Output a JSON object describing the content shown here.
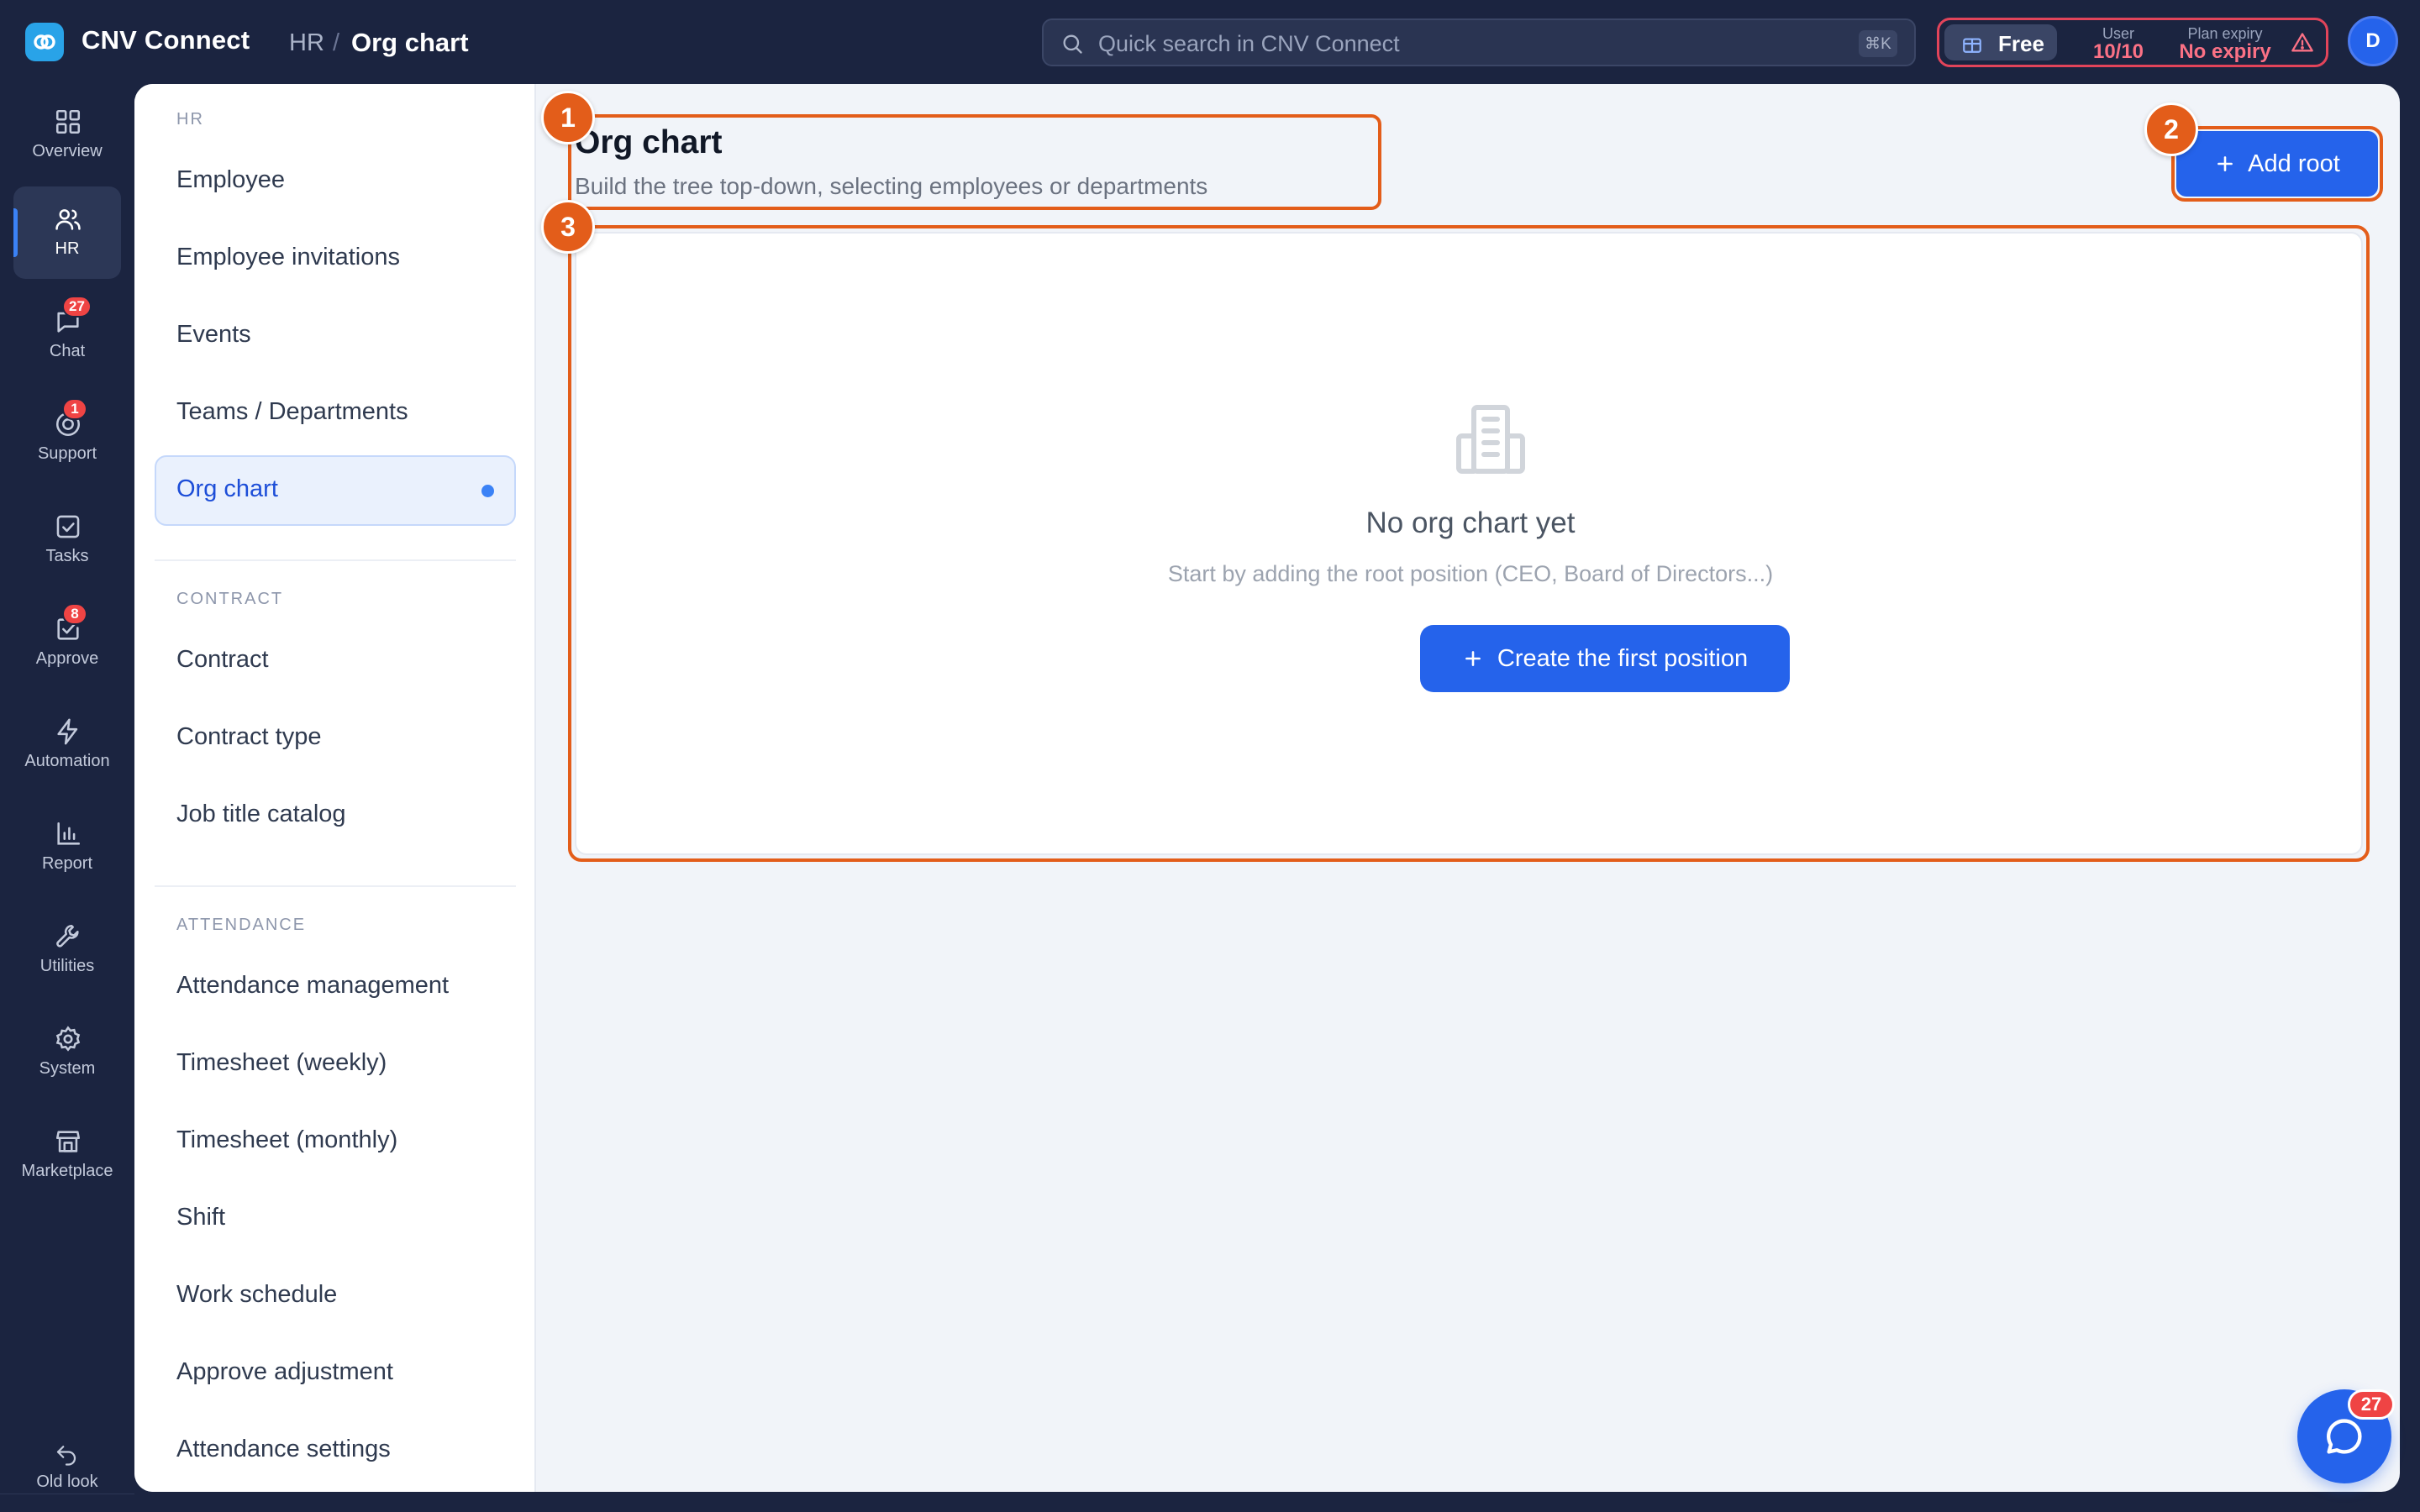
{
  "topbar": {
    "app_name": "CNV Connect",
    "breadcrumb": {
      "root": "HR",
      "separator": "/",
      "current": "Org chart"
    },
    "search": {
      "placeholder": "Quick search in CNV Connect",
      "shortcut": "⌘K"
    },
    "plan": {
      "name": "Free",
      "user_caption": "User",
      "user_value": "10/10",
      "expiry_caption": "Plan expiry",
      "expiry_value": "No expiry"
    },
    "avatar_initial": "D"
  },
  "rail": {
    "items": [
      {
        "label": "Overview",
        "icon": "grid-icon"
      },
      {
        "label": "HR",
        "icon": "users-icon",
        "active": true
      },
      {
        "label": "Chat",
        "icon": "chat-icon",
        "badge": "27"
      },
      {
        "label": "Support",
        "icon": "support-icon",
        "badge": "1"
      },
      {
        "label": "Tasks",
        "icon": "task-check-icon"
      },
      {
        "label": "Approve",
        "icon": "approve-icon",
        "badge": "8"
      },
      {
        "label": "Automation",
        "icon": "lightning-icon"
      },
      {
        "label": "Report",
        "icon": "bar-chart-icon"
      },
      {
        "label": "Utilities",
        "icon": "wrench-icon"
      },
      {
        "label": "System",
        "icon": "gear-icon"
      },
      {
        "label": "Marketplace",
        "icon": "store-icon"
      }
    ],
    "old_look": "Old look"
  },
  "subnav": {
    "sections": [
      {
        "title": "HR",
        "items": [
          "Employee",
          "Employee invitations",
          "Events",
          "Teams / Departments",
          "Org chart"
        ]
      },
      {
        "title": "CONTRACT",
        "items": [
          "Contract",
          "Contract type",
          "Job title catalog"
        ]
      },
      {
        "title": "ATTENDANCE",
        "items": [
          "Attendance management",
          "Timesheet (weekly)",
          "Timesheet (monthly)",
          "Shift",
          "Work schedule",
          "Approve adjustment",
          "Attendance settings"
        ]
      }
    ],
    "active_item": "Org chart"
  },
  "main": {
    "title": "Org chart",
    "subtitle": "Build the tree top-down, selecting employees or departments",
    "add_root_label": "Add root",
    "empty": {
      "title": "No org chart yet",
      "subtitle": "Start by adding the root position (CEO, Board of Directors...)",
      "button": "Create the first position"
    },
    "callouts": [
      "1",
      "2",
      "3"
    ]
  },
  "chat_fab": {
    "badge": "27"
  },
  "colors": {
    "shell": "#1b2440",
    "primary": "#2563eb",
    "highlight": "#e35d1a",
    "badge": "#ef4444",
    "plan_alert": "#fb7185"
  }
}
